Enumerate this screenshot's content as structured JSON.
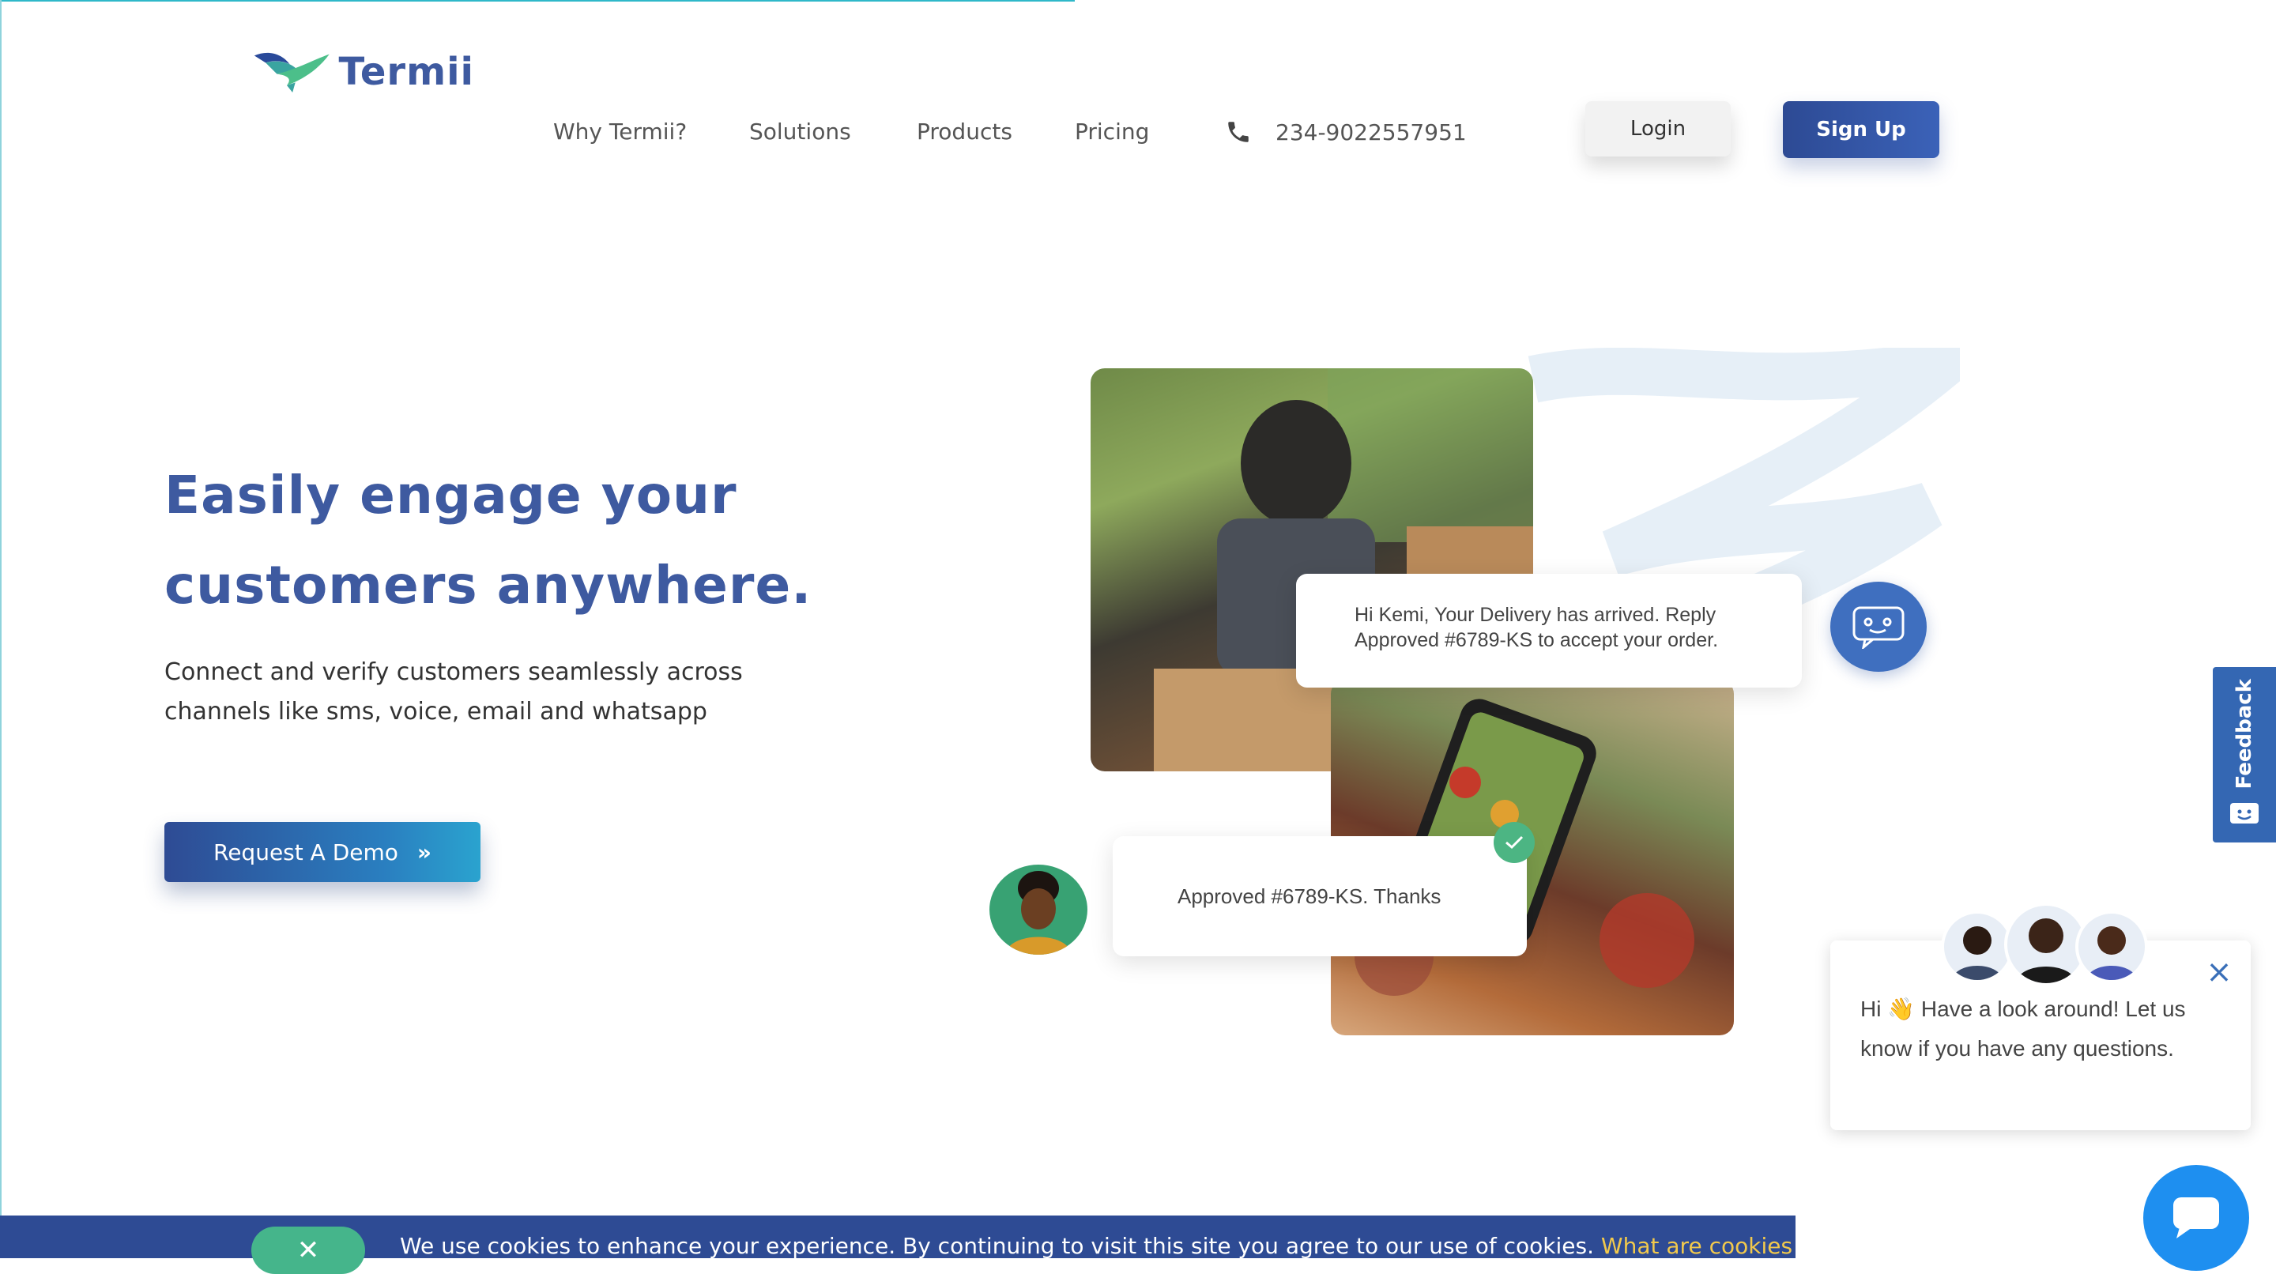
{
  "brand": {
    "name": "Termii"
  },
  "nav": {
    "items": [
      {
        "label": "Why Termii?"
      },
      {
        "label": "Solutions"
      },
      {
        "label": "Products"
      },
      {
        "label": "Pricing"
      }
    ],
    "phone": "234-9022557951",
    "login": "Login",
    "signup": "Sign Up"
  },
  "hero": {
    "title_line1": "Easily engage your",
    "title_line2": "customers anywhere.",
    "subtitle_line1": "Connect and verify customers seamlessly across",
    "subtitle_line2": "channels like sms, voice, email and whatsapp",
    "cta": "Request A Demo",
    "cta_icon": "»"
  },
  "illustration": {
    "message_in_line1": "Hi Kemi, Your Delivery has arrived. Reply",
    "message_in_line2": "Approved #6789-KS to accept your order.",
    "message_out": "Approved #6789-KS. Thanks"
  },
  "feedback_tab": {
    "label": "Feedback"
  },
  "chat_widget": {
    "greeting_prefix": "Hi",
    "wave_emoji": "👋",
    "greeting_text": "Have a look around! Let us know if you have any questions."
  },
  "cookie_bar": {
    "close_icon": "✕",
    "text": "We use cookies to enhance your experience. By continuing to visit this site you agree to our use of cookies.",
    "link": "What are cookies"
  },
  "colors": {
    "brand_blue": "#3e5aa0",
    "accent_green": "#45b58b",
    "chat_blue": "#1e8ff0"
  }
}
